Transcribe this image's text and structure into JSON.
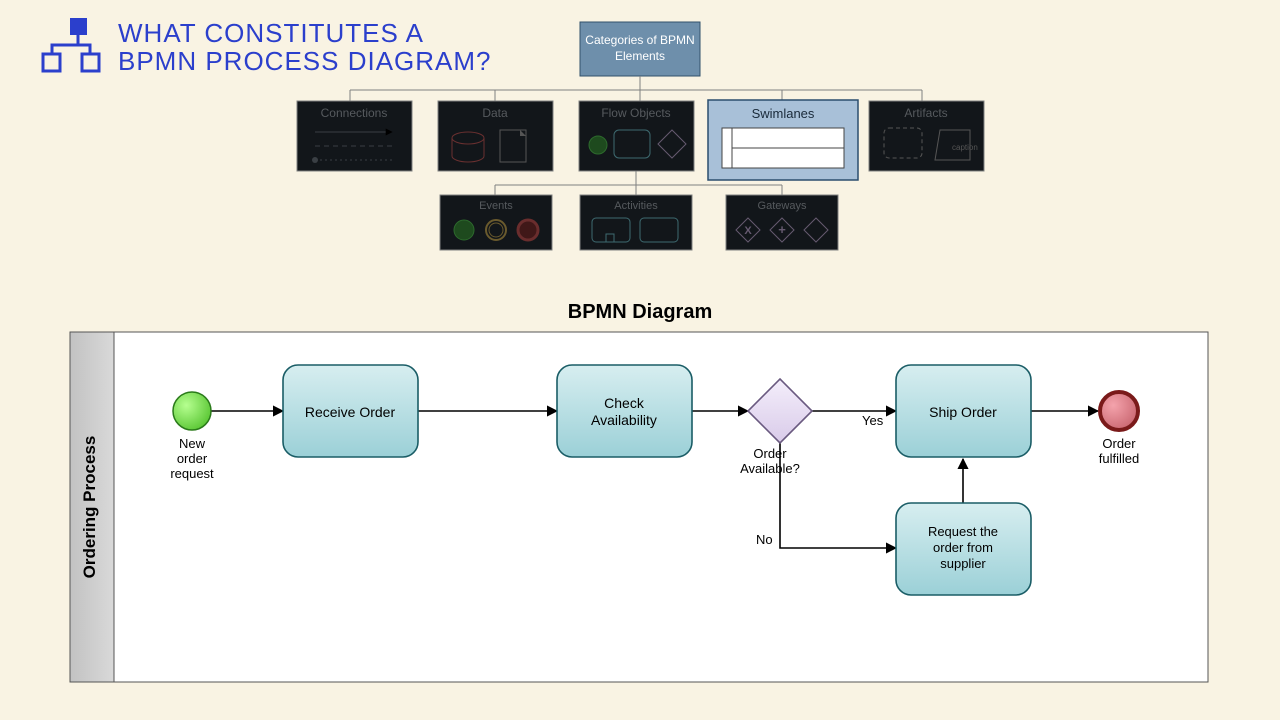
{
  "header": {
    "title_line1": "WHAT CONSTITUTES A",
    "title_line2": "BPMN PROCESS DIAGRAM?"
  },
  "tree": {
    "root": "Categories of BPMN Elements",
    "row1": [
      {
        "label": "Connections",
        "active": false
      },
      {
        "label": "Data",
        "active": false
      },
      {
        "label": "Flow Objects",
        "active": false
      },
      {
        "label": "Swimlanes",
        "active": true
      },
      {
        "label": "Artifacts",
        "active": false
      }
    ],
    "row2": [
      {
        "label": "Events",
        "active": false
      },
      {
        "label": "Activities",
        "active": false
      },
      {
        "label": "Gateways",
        "active": false
      }
    ]
  },
  "diagram": {
    "title": "BPMN Diagram",
    "lane_name": "Ordering Process",
    "start_label": "New order request",
    "end_label": "Order fulfilled",
    "task_receive": "Receive Order",
    "task_check": "Check Availability",
    "gateway_label": "Order Available?",
    "edge_yes": "Yes",
    "edge_no": "No",
    "task_ship": "Ship Order",
    "task_request": "Request the order from supplier"
  },
  "chart_data": {
    "type": "table",
    "title": "BPMN category hierarchy and ordering-process flow",
    "hierarchy": {
      "root": "Categories of BPMN Elements",
      "children": [
        "Connections",
        "Data",
        {
          "name": "Flow Objects",
          "children": [
            "Events",
            "Activities",
            "Gateways"
          ]
        },
        "Swimlanes",
        "Artifacts"
      ],
      "highlighted": "Swimlanes"
    },
    "process": {
      "lane": "Ordering Process",
      "nodes": [
        {
          "id": "start",
          "type": "startEvent",
          "label": "New order request"
        },
        {
          "id": "receive",
          "type": "task",
          "label": "Receive Order"
        },
        {
          "id": "check",
          "type": "task",
          "label": "Check Availability"
        },
        {
          "id": "gw",
          "type": "exclusiveGateway",
          "label": "Order Available?"
        },
        {
          "id": "ship",
          "type": "task",
          "label": "Ship Order"
        },
        {
          "id": "request",
          "type": "task",
          "label": "Request the order from supplier"
        },
        {
          "id": "end",
          "type": "endEvent",
          "label": "Order fulfilled"
        }
      ],
      "edges": [
        {
          "from": "start",
          "to": "receive"
        },
        {
          "from": "receive",
          "to": "check"
        },
        {
          "from": "check",
          "to": "gw"
        },
        {
          "from": "gw",
          "to": "ship",
          "label": "Yes"
        },
        {
          "from": "gw",
          "to": "request",
          "label": "No"
        },
        {
          "from": "request",
          "to": "ship"
        },
        {
          "from": "ship",
          "to": "end"
        }
      ]
    }
  }
}
